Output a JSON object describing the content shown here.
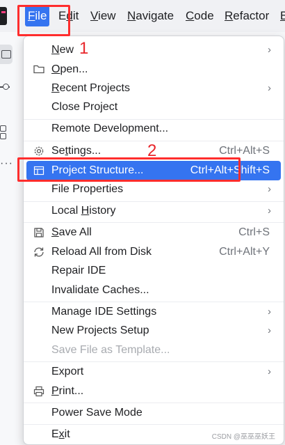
{
  "menubar": {
    "items": [
      {
        "pre": "",
        "mn": "F",
        "post": "ile"
      },
      {
        "pre": "E",
        "mn": "d",
        "post": "it"
      },
      {
        "pre": "",
        "mn": "V",
        "post": "iew"
      },
      {
        "pre": "",
        "mn": "N",
        "post": "avigate"
      },
      {
        "pre": "",
        "mn": "C",
        "post": "ode"
      },
      {
        "pre": "",
        "mn": "R",
        "post": "efactor"
      },
      {
        "pre": "",
        "mn": "B",
        "post": ""
      }
    ]
  },
  "menu": {
    "accent": "#3574f0",
    "items": [
      {
        "pre": "",
        "mn": "N",
        "post": "ew",
        "shortcut": "",
        "arrow": "›",
        "icon": ""
      },
      {
        "pre": "",
        "mn": "O",
        "post": "pen...",
        "shortcut": "",
        "arrow": "",
        "icon": "folder-icon"
      },
      {
        "pre": "",
        "mn": "R",
        "post": "ecent Projects",
        "shortcut": "",
        "arrow": "›",
        "icon": ""
      },
      {
        "pre": "Close Pro",
        "mn": "j",
        "post": "ect",
        "shortcut": "",
        "arrow": "",
        "icon": ""
      },
      {
        "pre": "Remote Development...",
        "mn": "",
        "post": "",
        "shortcut": "",
        "arrow": "",
        "icon": ""
      },
      {
        "pre": "Se",
        "mn": "t",
        "post": "tings...",
        "shortcut": "Ctrl+Alt+S",
        "arrow": "",
        "icon": "gear-icon"
      },
      {
        "pre": "Project Structure...",
        "mn": "",
        "post": "",
        "shortcut": "Ctrl+Alt+Shift+S",
        "arrow": "",
        "icon": "project-structure-icon"
      },
      {
        "pre": "File Properties",
        "mn": "",
        "post": "",
        "shortcut": "",
        "arrow": "›",
        "icon": ""
      },
      {
        "pre": "Local ",
        "mn": "H",
        "post": "istory",
        "shortcut": "",
        "arrow": "›",
        "icon": ""
      },
      {
        "pre": "",
        "mn": "S",
        "post": "ave All",
        "shortcut": "Ctrl+S",
        "arrow": "",
        "icon": "save-icon"
      },
      {
        "pre": "Reload All from Disk",
        "mn": "",
        "post": "",
        "shortcut": "Ctrl+Alt+Y",
        "arrow": "",
        "icon": "reload-icon"
      },
      {
        "pre": "Repair IDE",
        "mn": "",
        "post": "",
        "shortcut": "",
        "arrow": "",
        "icon": ""
      },
      {
        "pre": "Invalidate Caches...",
        "mn": "",
        "post": "",
        "shortcut": "",
        "arrow": "",
        "icon": ""
      },
      {
        "pre": "Manage IDE Settings",
        "mn": "",
        "post": "",
        "shortcut": "",
        "arrow": "›",
        "icon": ""
      },
      {
        "pre": "New Projects Setup",
        "mn": "",
        "post": "",
        "shortcut": "",
        "arrow": "›",
        "icon": ""
      },
      {
        "pre": "Save File as Template...",
        "mn": "",
        "post": "",
        "shortcut": "",
        "arrow": "",
        "icon": ""
      },
      {
        "pre": "Export",
        "mn": "",
        "post": "",
        "shortcut": "",
        "arrow": "›",
        "icon": ""
      },
      {
        "pre": "",
        "mn": "P",
        "post": "rint...",
        "shortcut": "",
        "arrow": "",
        "icon": "print-icon"
      },
      {
        "pre": "Power Save Mode",
        "mn": "",
        "post": "",
        "shortcut": "",
        "arrow": "",
        "icon": ""
      },
      {
        "pre": "E",
        "mn": "x",
        "post": "it",
        "shortcut": "",
        "arrow": "",
        "icon": ""
      }
    ]
  },
  "annotations": {
    "step1": "1",
    "step2": "2",
    "color": "#e8262b"
  },
  "watermark": "CSDN @巫巫巫妖王"
}
